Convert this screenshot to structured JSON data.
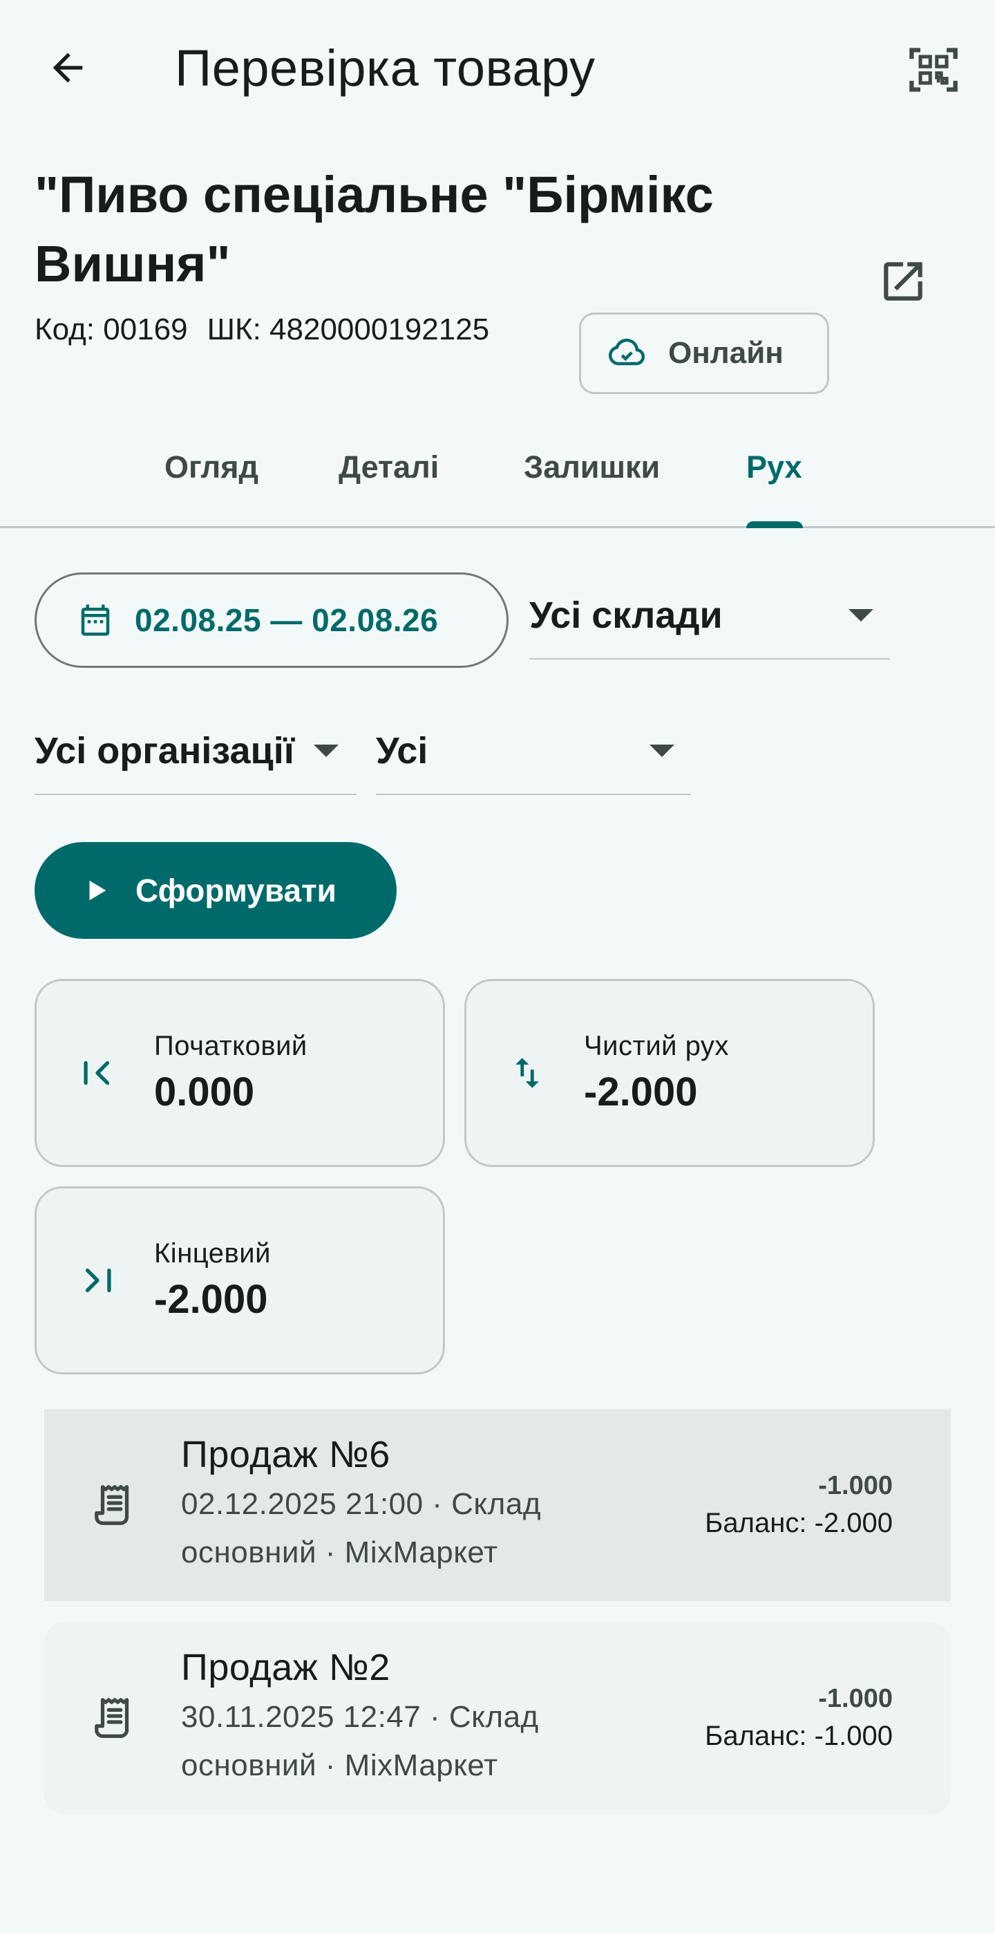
{
  "app_bar": {
    "title": "Перевірка товару",
    "back_icon": "arrow-back-icon",
    "scan_icon": "qr-scan-icon"
  },
  "product": {
    "name": "\"Пиво спеціальне \"Бірмікс Вишня\"",
    "code_label": "Код: 00169",
    "barcode_label": "ШК: 4820000192125",
    "online_label": "Онлайн"
  },
  "tabs": [
    {
      "label": "Огляд",
      "active": false
    },
    {
      "label": "Деталі",
      "active": false
    },
    {
      "label": "Залишки",
      "active": false
    },
    {
      "label": "Рух",
      "active": true
    }
  ],
  "filters": {
    "date_range": "02.08.25 — 02.08.26",
    "warehouse": "Усі склади",
    "organization": "Усі організації",
    "type": "Усі"
  },
  "generate_label": "Сформувати",
  "summary": {
    "start": {
      "label": "Початковий",
      "value": "0.000"
    },
    "net": {
      "label": "Чистий рух",
      "value": "-2.000"
    },
    "end": {
      "label": "Кінцевий",
      "value": "-2.000"
    }
  },
  "movements": [
    {
      "title": "Продаж №6",
      "subtitle_line1": "02.12.2025 21:00 · Склад",
      "subtitle_line2": "основний · MixМаркет",
      "qty": "-1.000",
      "balance": "Баланс: -2.000"
    },
    {
      "title": "Продаж №2",
      "subtitle_line1": "30.11.2025 12:47 · Склад",
      "subtitle_line2": "основний · MixМаркет",
      "qty": "-1.000",
      "balance": "Баланс: -1.000"
    }
  ],
  "colors": {
    "background": "#f3f9f9",
    "accent": "#006a6a",
    "text": "#161d1d",
    "outline": "#c0c8c8"
  }
}
